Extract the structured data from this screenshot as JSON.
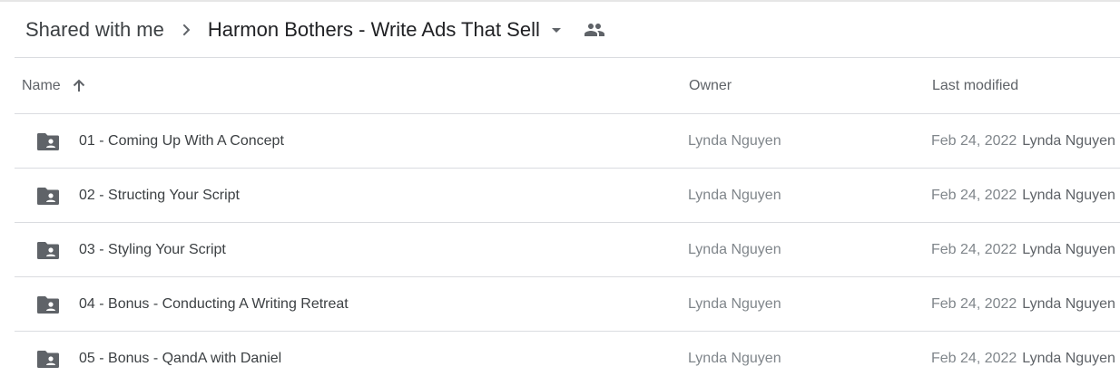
{
  "breadcrumb": {
    "parent": "Shared with me",
    "current": "Harmon Bothers - Write Ads That Sell"
  },
  "icons": {
    "separator": "chevron-right-icon",
    "caret": "caret-down-icon",
    "shared": "people-icon",
    "sort": "arrow-up-icon",
    "row": "shared-folder-icon"
  },
  "columns": {
    "name": "Name",
    "owner": "Owner",
    "last_modified": "Last modified"
  },
  "files": [
    {
      "name": "01 - Coming Up With A Concept",
      "owner": "Lynda Nguyen",
      "modified_date": "Feb 24, 2022",
      "modified_by": "Lynda Nguyen"
    },
    {
      "name": "02 - Structing Your Script",
      "owner": "Lynda Nguyen",
      "modified_date": "Feb 24, 2022",
      "modified_by": "Lynda Nguyen"
    },
    {
      "name": "03 - Styling Your Script",
      "owner": "Lynda Nguyen",
      "modified_date": "Feb 24, 2022",
      "modified_by": "Lynda Nguyen"
    },
    {
      "name": "04 - Bonus - Conducting A Writing Retreat",
      "owner": "Lynda Nguyen",
      "modified_date": "Feb 24, 2022",
      "modified_by": "Lynda Nguyen"
    },
    {
      "name": "05 - Bonus - QandA with Daniel",
      "owner": "Lynda Nguyen",
      "modified_date": "Feb 24, 2022",
      "modified_by": "Lynda Nguyen"
    }
  ],
  "colors": {
    "text_primary": "#3c4043",
    "text_secondary": "#5f6368",
    "text_muted": "#80868b",
    "divider": "#dadce0",
    "icon": "#5f6368"
  }
}
